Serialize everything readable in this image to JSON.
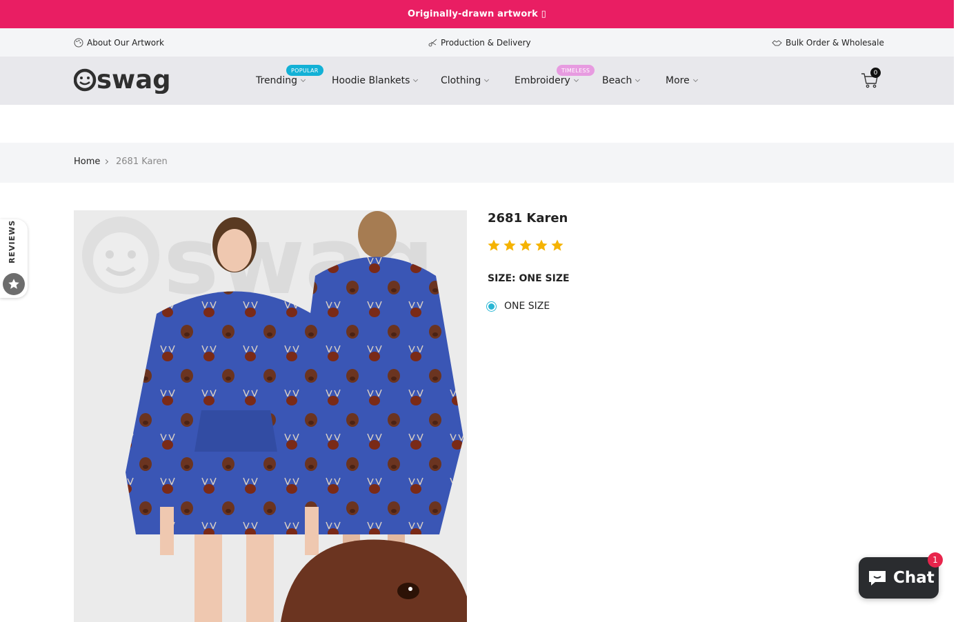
{
  "announcement": {
    "text": "Originally-drawn artwork ▯"
  },
  "info_bar": {
    "about": "About Our Artwork",
    "production": "Production & Delivery",
    "wholesale": "Bulk Order & Wholesale"
  },
  "header": {
    "logo_text": "swag",
    "nav": [
      {
        "label": "Trending",
        "badge": "POPULAR"
      },
      {
        "label": "Hoodie Blankets"
      },
      {
        "label": "Clothing"
      },
      {
        "label": "Embroidery",
        "badge": "TIMELESS"
      },
      {
        "label": "Beach"
      },
      {
        "label": "More"
      }
    ],
    "cart_count": "0"
  },
  "breadcrumb": {
    "home": "Home",
    "current": "2681 Karen"
  },
  "product": {
    "title": "2681 Karen",
    "rating": 5,
    "size_label": "SIZE: ONE SIZE",
    "size_option": "ONE SIZE",
    "watermark": "swag"
  },
  "reviews_tab": {
    "label": "REVIEWS"
  },
  "chat": {
    "label": "Chat",
    "badge": "1"
  },
  "colors": {
    "accent": "#e91e63",
    "star": "#f5b301",
    "radio": "#29b6d4",
    "product_blue": "#3a56b5",
    "chat_bg": "#2a2c2f"
  }
}
